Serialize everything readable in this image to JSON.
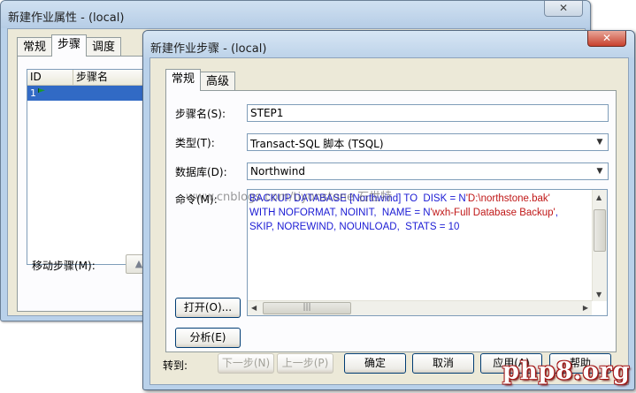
{
  "back_window": {
    "title": "新建作业属性 - (local)",
    "close_label": "✕",
    "tabs": [
      {
        "label": "常规",
        "active": false
      },
      {
        "label": "步骤",
        "active": true
      },
      {
        "label": "调度",
        "active": false
      }
    ],
    "list": {
      "columns": [
        "ID",
        "步骤名"
      ],
      "rows": [
        {
          "id": "1",
          "name": ""
        }
      ]
    },
    "move_steps_label": "移动步骤(M):"
  },
  "front_window": {
    "title": "新建作业步骤 - (local)",
    "close_label": "✕",
    "tabs": [
      {
        "label": "常规",
        "active": true
      },
      {
        "label": "高级",
        "active": false
      }
    ],
    "step_name_label": "步骤名(S):",
    "step_name_value": "STEP1",
    "type_label": "类型(T):",
    "type_value": "Transact-SQL 脚本 (TSQL)",
    "database_label": "数据库(D):",
    "database_value": "Northwind",
    "command_label": "命令(M):",
    "command": {
      "line1_kw": "BACKUP DATABASE [Northwind] TO  DISK = N",
      "line1_str": "'D:\\northstone.bak'",
      "line2_kw": "WITH NOFORMAT, NOINIT,  NAME = N",
      "line2_str": "'wxh-Full Database Backup'",
      "line2_end": ",",
      "line3": "SKIP, NOREWIND, NOUNLOAD,  STATS = 10"
    },
    "open_button": "打开(O)...",
    "parse_button": "分析(E)",
    "goto_label": "转到:",
    "next_step_button": "下一步(N)",
    "prev_step_button": "上一步(P)",
    "ok_button": "确定",
    "cancel_button": "取消",
    "apply_button": "应用(A)",
    "help_button": "帮助"
  },
  "watermark": "www.cnblogs.com/tiyonstone 石世特",
  "site_logo": "php8.org",
  "colors": {
    "selection": "#316ac5",
    "sql_keyword": "#1b1bd4",
    "sql_string": "#c01818",
    "logo_red": "#a31717"
  }
}
